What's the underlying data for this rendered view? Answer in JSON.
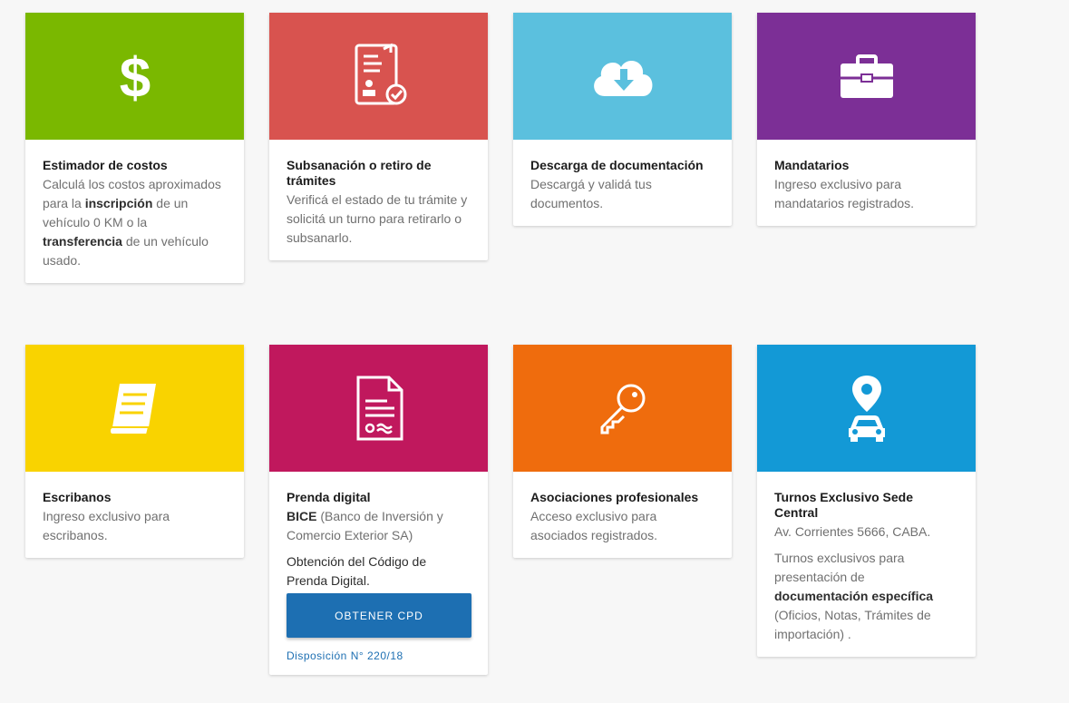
{
  "colors": {
    "green": "#7ab800",
    "red": "#d8534f",
    "lightblue": "#5bc0de",
    "purple": "#7c2f96",
    "yellow": "#f9d300",
    "magenta": "#c0185d",
    "orange": "#ef6c0d",
    "blue": "#1399d6",
    "button": "#1d6fb2"
  },
  "cards": [
    {
      "title": "Estimador de costos",
      "icon": "dollar-icon",
      "desc_parts": [
        "Calculá los costos aproximados para la ",
        "inscripción",
        " de un vehículo 0 KM o la ",
        "transferencia",
        " de un vehículo usado."
      ]
    },
    {
      "title": "Subsanación o retiro de trámites",
      "icon": "document-check-icon",
      "desc": "Verificá el estado de tu trámite y solicitá un turno para retirarlo o subsanarlo."
    },
    {
      "title": "Descarga de documentación",
      "icon": "cloud-download-icon",
      "desc": "Descargá y validá tus documentos."
    },
    {
      "title": "Mandatarios",
      "icon": "briefcase-icon",
      "desc": "Ingreso exclusivo para mandatarios registrados."
    },
    {
      "title": "Escribanos",
      "icon": "book-icon",
      "desc": "Ingreso exclusivo para escribanos."
    },
    {
      "title": "Prenda digital",
      "icon": "contract-icon",
      "desc_parts": [
        "BICE",
        " (Banco de Inversión y Comercio Exterior SA)"
      ],
      "desc2": "Obtención del Código de Prenda Digital.",
      "button": "OBTENER CPD",
      "link": "Disposición N° 220/18"
    },
    {
      "title": "Asociaciones profesionales",
      "icon": "key-icon",
      "desc": "Acceso exclusivo para asociados registrados."
    },
    {
      "title": "Turnos Exclusivo Sede Central",
      "icon": "location-car-icon",
      "desc": "Av. Corrientes 5666, CABA.",
      "desc_parts": [
        "Turnos exclusivos para presentación de ",
        "documentación específica",
        " (Oficios, Notas, Trámites de importación) ."
      ]
    }
  ]
}
